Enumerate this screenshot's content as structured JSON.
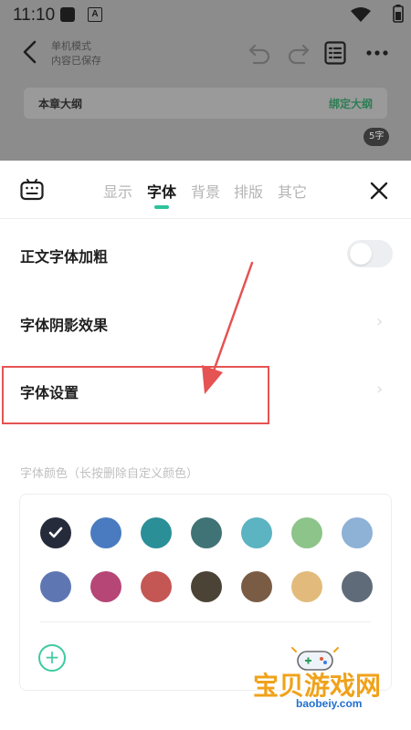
{
  "status_bar": {
    "time": "11:10",
    "notification_glyph": "A"
  },
  "editor": {
    "mode": "单机模式",
    "saved": "内容已保存",
    "chapter_outline_label": "本章大纲",
    "bind_outline_label": "绑定大纲",
    "word_count": "5字"
  },
  "tabs": [
    {
      "label": "显示",
      "active": false
    },
    {
      "label": "字体",
      "active": true
    },
    {
      "label": "背景",
      "active": false
    },
    {
      "label": "排版",
      "active": false
    },
    {
      "label": "其它",
      "active": false
    }
  ],
  "settings": {
    "bold_body_label": "正文字体加粗",
    "bold_body_enabled": false,
    "shadow_label": "字体阴影效果",
    "font_settings_label": "字体设置",
    "color_title": "字体颜色（长按删除自定义颜色）"
  },
  "colors": [
    "#252b3b",
    "#4a7bc0",
    "#2b8f98",
    "#407376",
    "#5cb3c1",
    "#8dc489",
    "#8eb1d6",
    "#5e77b3",
    "#b54676",
    "#c45654",
    "#4b4436",
    "#7a5c45",
    "#e2bb7c",
    "#5f6b79"
  ],
  "selected_color_index": 0,
  "accent_color": "#2fc29a",
  "annotation_color": "#e55353",
  "watermark": {
    "name": "宝贝游戏网",
    "url": "baobeiy.com"
  }
}
